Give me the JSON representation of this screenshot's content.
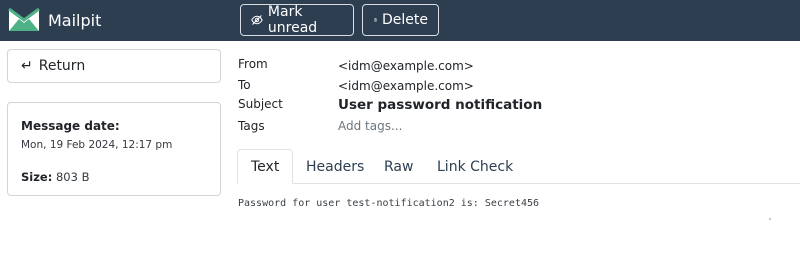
{
  "app": {
    "name": "Mailpit"
  },
  "toolbar": {
    "mark_unread_label": "Mark unread",
    "delete_label": "Delete"
  },
  "sidebar": {
    "return_label": "Return",
    "message_date_label": "Message date:",
    "message_date_value": "Mon, 19 Feb 2024, 12:17 pm",
    "size_label": "Size:",
    "size_value": "803 B"
  },
  "message": {
    "from_label": "From",
    "from_value": "<idm@example.com>",
    "to_label": "To",
    "to_value": "<idm@example.com>",
    "subject_label": "Subject",
    "subject_value": "User password notification",
    "tags_label": "Tags",
    "tags_placeholder": "Add tags..."
  },
  "tabs": [
    {
      "label": "Text",
      "active": true
    },
    {
      "label": "Headers",
      "active": false
    },
    {
      "label": "Raw",
      "active": false
    },
    {
      "label": "Link Check",
      "active": false
    }
  ],
  "body": {
    "text": "Password for user test-notification2 is: Secret456"
  },
  "colors": {
    "topbar": "#2c3e50",
    "logo_green": "#4fb286"
  },
  "icons": {
    "logo": "mailpit-logo-icon",
    "mark_unread": "eye-slash-icon",
    "delete": "trash-icon",
    "return": "return-arrow-icon"
  }
}
